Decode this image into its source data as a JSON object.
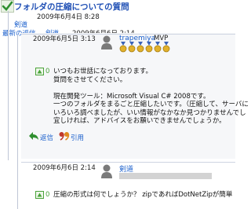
{
  "thread": {
    "title": "フォルダの圧縮についての質問",
    "date": "2009年6月4日 8:28",
    "author": "剣道",
    "latest_prefix": "最新の返信",
    "latest_author": "剣道",
    "latest_date": "2009年6月6日 2:14"
  },
  "reply1": {
    "date": "2009年6月5日 3:13",
    "author": "trapemiya",
    "badge": "MVP",
    "votes": "0",
    "text": [
      "いつもお世話になっております。",
      "質問をさせてください。",
      "",
      "現在開発ツール：Microsoft Visual C# 2008です。",
      "一つのフォルダをまるごと圧縮したいです。（圧縮して、サーバに",
      "いろいろ調べましたが、いい情報がなかなか見つかりませんでし",
      "宜しければ、アドバイスをお願いできませんでしょうか。"
    ],
    "reply_label": "返信",
    "quote_label": "引用"
  },
  "reply2": {
    "date": "2009年6月6日 2:14",
    "author": "剣道",
    "votes": "0",
    "text": "圧縮の形式は何でしょうか？ zipであればDotNetZipが簡単"
  },
  "colors": {
    "title_blue": "#1f4fb5",
    "link_blue": "#1a5fcc",
    "vote_green": "#4aa33a",
    "medal_gold": "#e1b12c"
  },
  "icons": [
    "answered-check-icon",
    "avatar-icon",
    "mvp-medal-icon",
    "vote-up-icon",
    "reply-arrow-icon",
    "quote-icon"
  ]
}
